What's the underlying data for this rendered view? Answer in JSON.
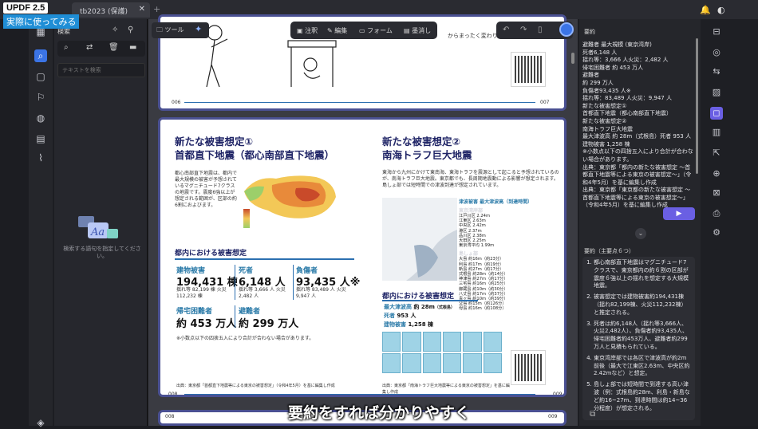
{
  "app": {
    "name": "UPDF 2.5",
    "tag": "実際に使ってみる"
  },
  "tabs": [
    {
      "label": "tb2023 (保護)"
    }
  ],
  "search_panel": {
    "title": "検索",
    "placeholder": "テキストを検索",
    "hint": "検索する語句を指定してください。"
  },
  "toolbar": {
    "tool_label": "ツール",
    "annotate_label": "注釈",
    "edit_label": "編集",
    "form_label": "フォーム",
    "redact_label": "墨消し"
  },
  "page1": {
    "text_top": "からまったく変わります",
    "page_left": "006",
    "page_right": "007"
  },
  "page2": {
    "left": {
      "heading1": "新たな被害想定①",
      "heading2": "首都直下地震（都心南部直下地震）",
      "intro": "都心南部直下地震は、都内で最大規模の被害が予想されているマグニチュード7クラスの地震です。震度6強以上が想定される範囲が、区部の約6割におよびます。",
      "section": "都内における被害想定",
      "buildings_label": "建物被害",
      "buildings_value": "194,431 棟",
      "buildings_detail": "揺れ等 82,199 棟 火災 112,232 棟",
      "deaths_label": "死者",
      "deaths_value": "6,148 人",
      "deaths_detail": "揺れ等 3,666 人 火災 2,482 人",
      "injured_label": "負傷者",
      "injured_value": "93,435 人※",
      "injured_detail": "揺れ等 83,489 人 火災 9,947 人",
      "stranded_label": "帰宅困難者",
      "stranded_value": "約 453 万人",
      "evacuees_label": "避難者",
      "evacuees_value": "約 299 万人",
      "footnote": "※小数点以下の四捨五入により合計が合わない場合があります。",
      "source": "出典：東京都「首都直下地震等による東京の被害想定」（令和4年5月）を基に編集し作成",
      "page_no": "008"
    },
    "right": {
      "heading1": "新たな被害想定②",
      "heading2": "南海トラフ巨大地震",
      "intro": "東海から九州にかけて東南海、東海トラフを震源として起こると予想されているのが、南海トラフ巨大地震。東京都でも、長周期地震動による影響が想定されます。島しょ部では短時間での津波到達が想定されています。",
      "tsunami_title": "津波被害 最大津波高（到達時間）",
      "tsunami_east": "東京湾岸部",
      "tsunami_list": [
        "江戸川区 2.24m",
        "江東区 2.63m",
        "中央区 2.42m",
        "港区 2.37m",
        "品川区 2.38m",
        "大田区 2.25m",
        "東京湾平均 1.99m"
      ],
      "islands_title": "島しょ部",
      "islands_list": [
        "大島 約16m（約23分）",
        "利島 約17m（約19分）",
        "新島 約27m（約17分）",
        "式根島 約28m（約14分）",
        "神津島 約27m（約17分）",
        "三宅島 約16m（約25分）",
        "御蔵島 約10m（約30分）",
        "八丈島 約17m（約37分）",
        "青ヶ島 約10m（約39分）",
        "父島 約15m（約126分）",
        "母島 約16m（約108分）"
      ],
      "section": "都内における被害想定",
      "tsunami_label": "最大津波高",
      "tsunami_value": "約 28m",
      "tsunami_note": "（式根島）",
      "deaths_label": "死者",
      "deaths_value": "953 人",
      "buildings_label": "建物被害",
      "buildings_value": "1,258 棟",
      "source": "出典：東京都「南海トラフ巨大地震等による東京の被害想定」を基に編集し作成",
      "page_no": "009"
    }
  },
  "page3": {
    "left_no": "008",
    "right_no": "009"
  },
  "ai_panel": {
    "title": "要約",
    "summary1": [
      "避難者 最大規模 (東京湾岸)",
      "死者6,148 人",
      "揺れ等：3,666 人火災：2,482 人",
      "帰宅困難者 約 453 万人",
      "避難者",
      "約 299 万人",
      "負傷者93,435 人※",
      "揺れ等：83,489 人火災：9,947 人",
      "新たな被害想定①",
      "首都直下地震（都心南部直下地震）",
      "新たな被害想定②",
      "南海トラフ巨大地震",
      "最大津波高 約 28m（式根島）死者 953 人",
      "建物被害 1,258 棟",
      "※小数点以下の四捨五入により合計が合わない場合があります。",
      "出典：東京都「都内の新たな被害想定 ～首都直下地震等による東京の被害想定～」（令和4年5月）を基に編集し作成",
      "出典：東京都「東京都の新たな被害想定 ～首都直下地震等による東京の被害想定～」（令和4年5月）を基に編集し作成"
    ],
    "send_label": "▶",
    "summary2_title": "要約（主要点６つ）",
    "summary2": [
      "都心南部直下地震はマグニチュード7クラスで、東京都内の約６割の区部が震度６強以上の揺れを想定する大規模地震。",
      "被害想定では建物被害約194,431棟（揺れ82,199棟、火災112,232棟）と推定される。",
      "死者は約6,148人（揺れ等3,666人、火災2,482人）、負傷者約93,435人、帰宅困難者約453万人、避難者約299万人と見積もられている。",
      "東京湾岸部では各区で津波高が約2m前後（最大で江東区2.63m、中央区約2.42mなど）と想定。",
      "島しょ部では短時間で到達する高い津波（例：式根島約28m、利島・新島など約16~27m、到達時間は約14~36分程度）が想定される。"
    ]
  },
  "subtitle": "要約をすれば分かりやすく",
  "colors": {
    "accent": "#6a5fe3",
    "page_border": "#4a5092",
    "heading": "#1f2466",
    "stat": "#2a7aa8"
  }
}
